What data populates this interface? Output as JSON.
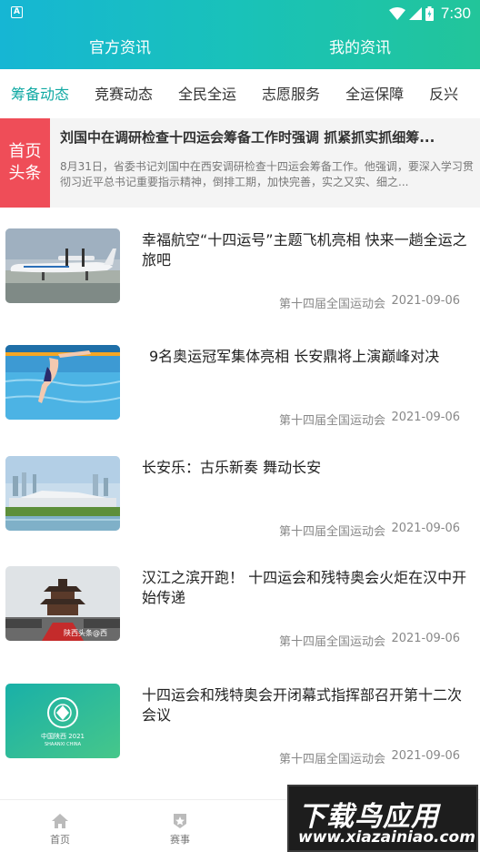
{
  "status_bar": {
    "time": "7:30",
    "app_icon_letter": "A"
  },
  "top_tabs": [
    {
      "label": "官方资讯"
    },
    {
      "label": "我的资讯"
    }
  ],
  "sub_tabs": [
    {
      "label": "筹备动态"
    },
    {
      "label": "竞赛动态"
    },
    {
      "label": "全民全运"
    },
    {
      "label": "志愿服务"
    },
    {
      "label": "全运保障"
    },
    {
      "label": "反兴"
    }
  ],
  "headline": {
    "badge_line1": "首页",
    "badge_line2": "头条",
    "title": "刘国中在调研检查十四运会筹备工作时强调 抓紧抓实抓细筹...",
    "desc": "8月31日，省委书记刘国中在西安调研检查十四运会筹备工作。他强调，要深入学习贯彻习近平总书记重要指示精神，倒排工期，加快完善，实之又实、细之..."
  },
  "news": [
    {
      "title": "幸福航空“十四运号”主题飞机亮相 快来一趟全运之旅吧",
      "source": "第十四届全国运动会",
      "date": "2021-09-06"
    },
    {
      "title": "9名奥运冠军集体亮相 长安鼎将上演巅峰对决",
      "source": "第十四届全国运动会",
      "date": "2021-09-06"
    },
    {
      "title": "长安乐：古乐新奏 舞动长安",
      "source": "第十四届全国运动会",
      "date": "2021-09-06"
    },
    {
      "title": "汉江之滨开跑！ 十四运会和残特奥会火炬在汉中开始传递",
      "source": "第十四届全国运动会",
      "date": "2021-09-06"
    },
    {
      "title": "十四运会和残特奥会开闭幕式指挥部召开第十二次会议",
      "source": "第十四届全国运动会",
      "date": "2021-09-06"
    }
  ],
  "thumb_texts": {
    "photo_watermark": "陕西头条@西",
    "logo_line1": "中国陕西 2021",
    "logo_line2": "SHAANXI CHINA"
  },
  "bottom_nav": [
    {
      "label": "首页",
      "icon": "home-icon"
    },
    {
      "label": "赛事",
      "icon": "medal-icon"
    }
  ],
  "watermark": {
    "main": "下载鸟应用",
    "sub": "www.xiazainiao.com"
  },
  "colors": {
    "header_start": "#16b6d4",
    "header_end": "#22c59a",
    "active_tab": "#11a9a3",
    "badge": "#ef4d58"
  }
}
